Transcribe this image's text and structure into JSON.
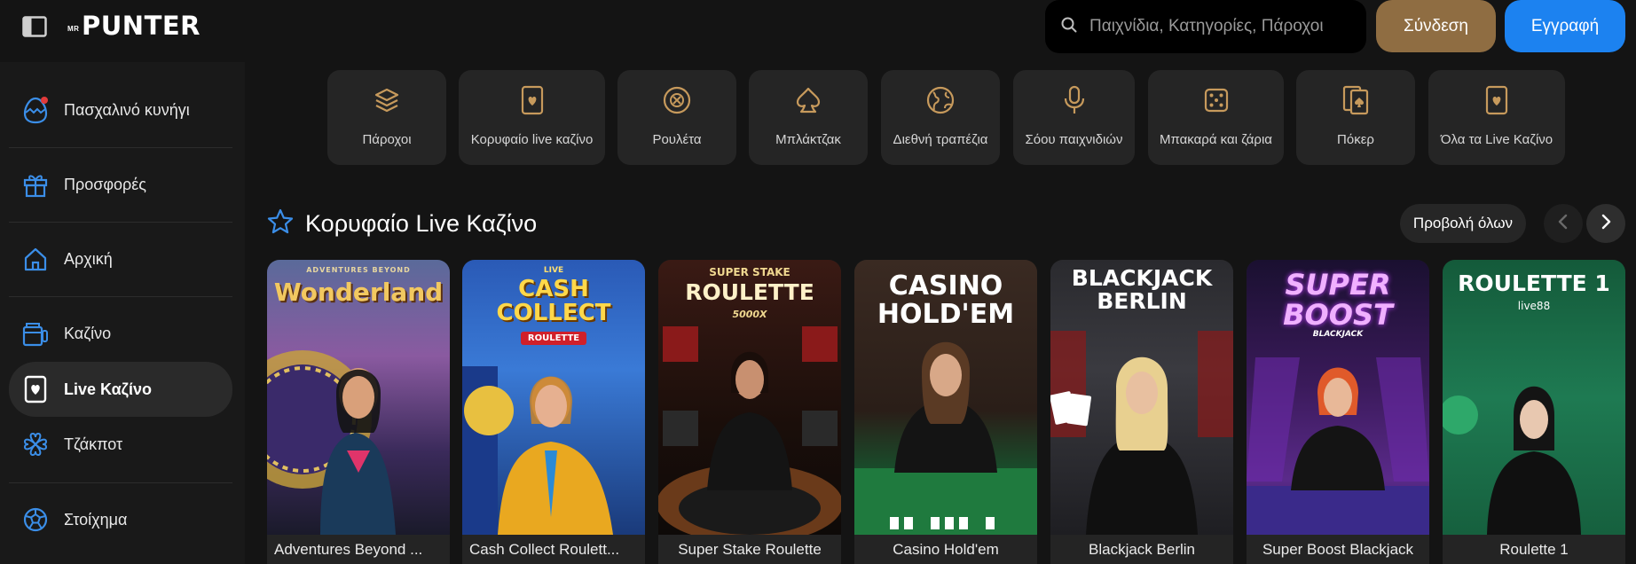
{
  "header": {
    "logo_prefix": "MR",
    "logo_main": "PUNTER",
    "search_placeholder": "Παιχνίδια, Κατηγορίες, Πάροχοι",
    "login_label": "Σύνδεση",
    "register_label": "Εγγραφή"
  },
  "sidebar": {
    "items": [
      {
        "label": "Πασχαλινό κυνήγι",
        "icon": "easter-egg-icon"
      },
      {
        "label": "Προσφορές",
        "icon": "gift-icon"
      },
      {
        "label": "Αρχική",
        "icon": "home-icon"
      },
      {
        "label": "Καζίνο",
        "icon": "casino-icon"
      },
      {
        "label": "Live Καζίνο",
        "icon": "live-card-icon"
      },
      {
        "label": "Τζάκποτ",
        "icon": "jackpot-clover-icon"
      },
      {
        "label": "Στοίχημα",
        "icon": "soccer-ball-icon"
      }
    ]
  },
  "categories": [
    {
      "label": "Πάροχοι",
      "icon": "layers-icon"
    },
    {
      "label": "Κορυφαίο live καζίνο",
      "icon": "card-heart-icon"
    },
    {
      "label": "Ρουλέτα",
      "icon": "roulette-icon"
    },
    {
      "label": "Μπλάκτζακ",
      "icon": "spade-icon"
    },
    {
      "label": "Διεθνή τραπέζια",
      "icon": "globe-icon"
    },
    {
      "label": "Σόου παιχνιδιών",
      "icon": "microphone-icon"
    },
    {
      "label": "Μπακαρά και ζάρια",
      "icon": "dice-icon"
    },
    {
      "label": "Πόκερ",
      "icon": "poker-cards-icon"
    },
    {
      "label": "Όλα τα Live Καζίνο",
      "icon": "card-heart-icon"
    }
  ],
  "section": {
    "title": "Κορυφαίο Live Καζίνο",
    "view_all": "Προβολή όλων"
  },
  "games": [
    {
      "title": "Adventures Beyond ...",
      "art_top": "ADVENTURES BEYOND",
      "art_main": "Wonderland",
      "accent": "#7a4fa8"
    },
    {
      "title": "Cash Collect Roulett...",
      "art_top": "LIVE",
      "art_main": "CASH COLLECT",
      "art_sub": "ROULETTE",
      "accent": "#2a6fd6"
    },
    {
      "title": "Super Stake Roulette",
      "art_top": "SUPER STAKE",
      "art_main": "ROULETTE",
      "art_sub": "5000X",
      "accent": "#5a1a1a"
    },
    {
      "title": "Casino Hold'em",
      "art_main": "CASINO HOLD'EM",
      "accent": "#1f6b3a"
    },
    {
      "title": "Blackjack Berlin",
      "art_main": "BLACKJACK BERLIN",
      "accent": "#3a3a44"
    },
    {
      "title": "Super Boost Blackjack",
      "art_main": "SUPER BOOST",
      "art_sub": "BLACKJACK",
      "accent": "#4a1a6a"
    },
    {
      "title": "Roulette 1",
      "art_main": "ROULETTE 1",
      "art_sub": "live88",
      "accent": "#1d6b4a"
    }
  ]
}
